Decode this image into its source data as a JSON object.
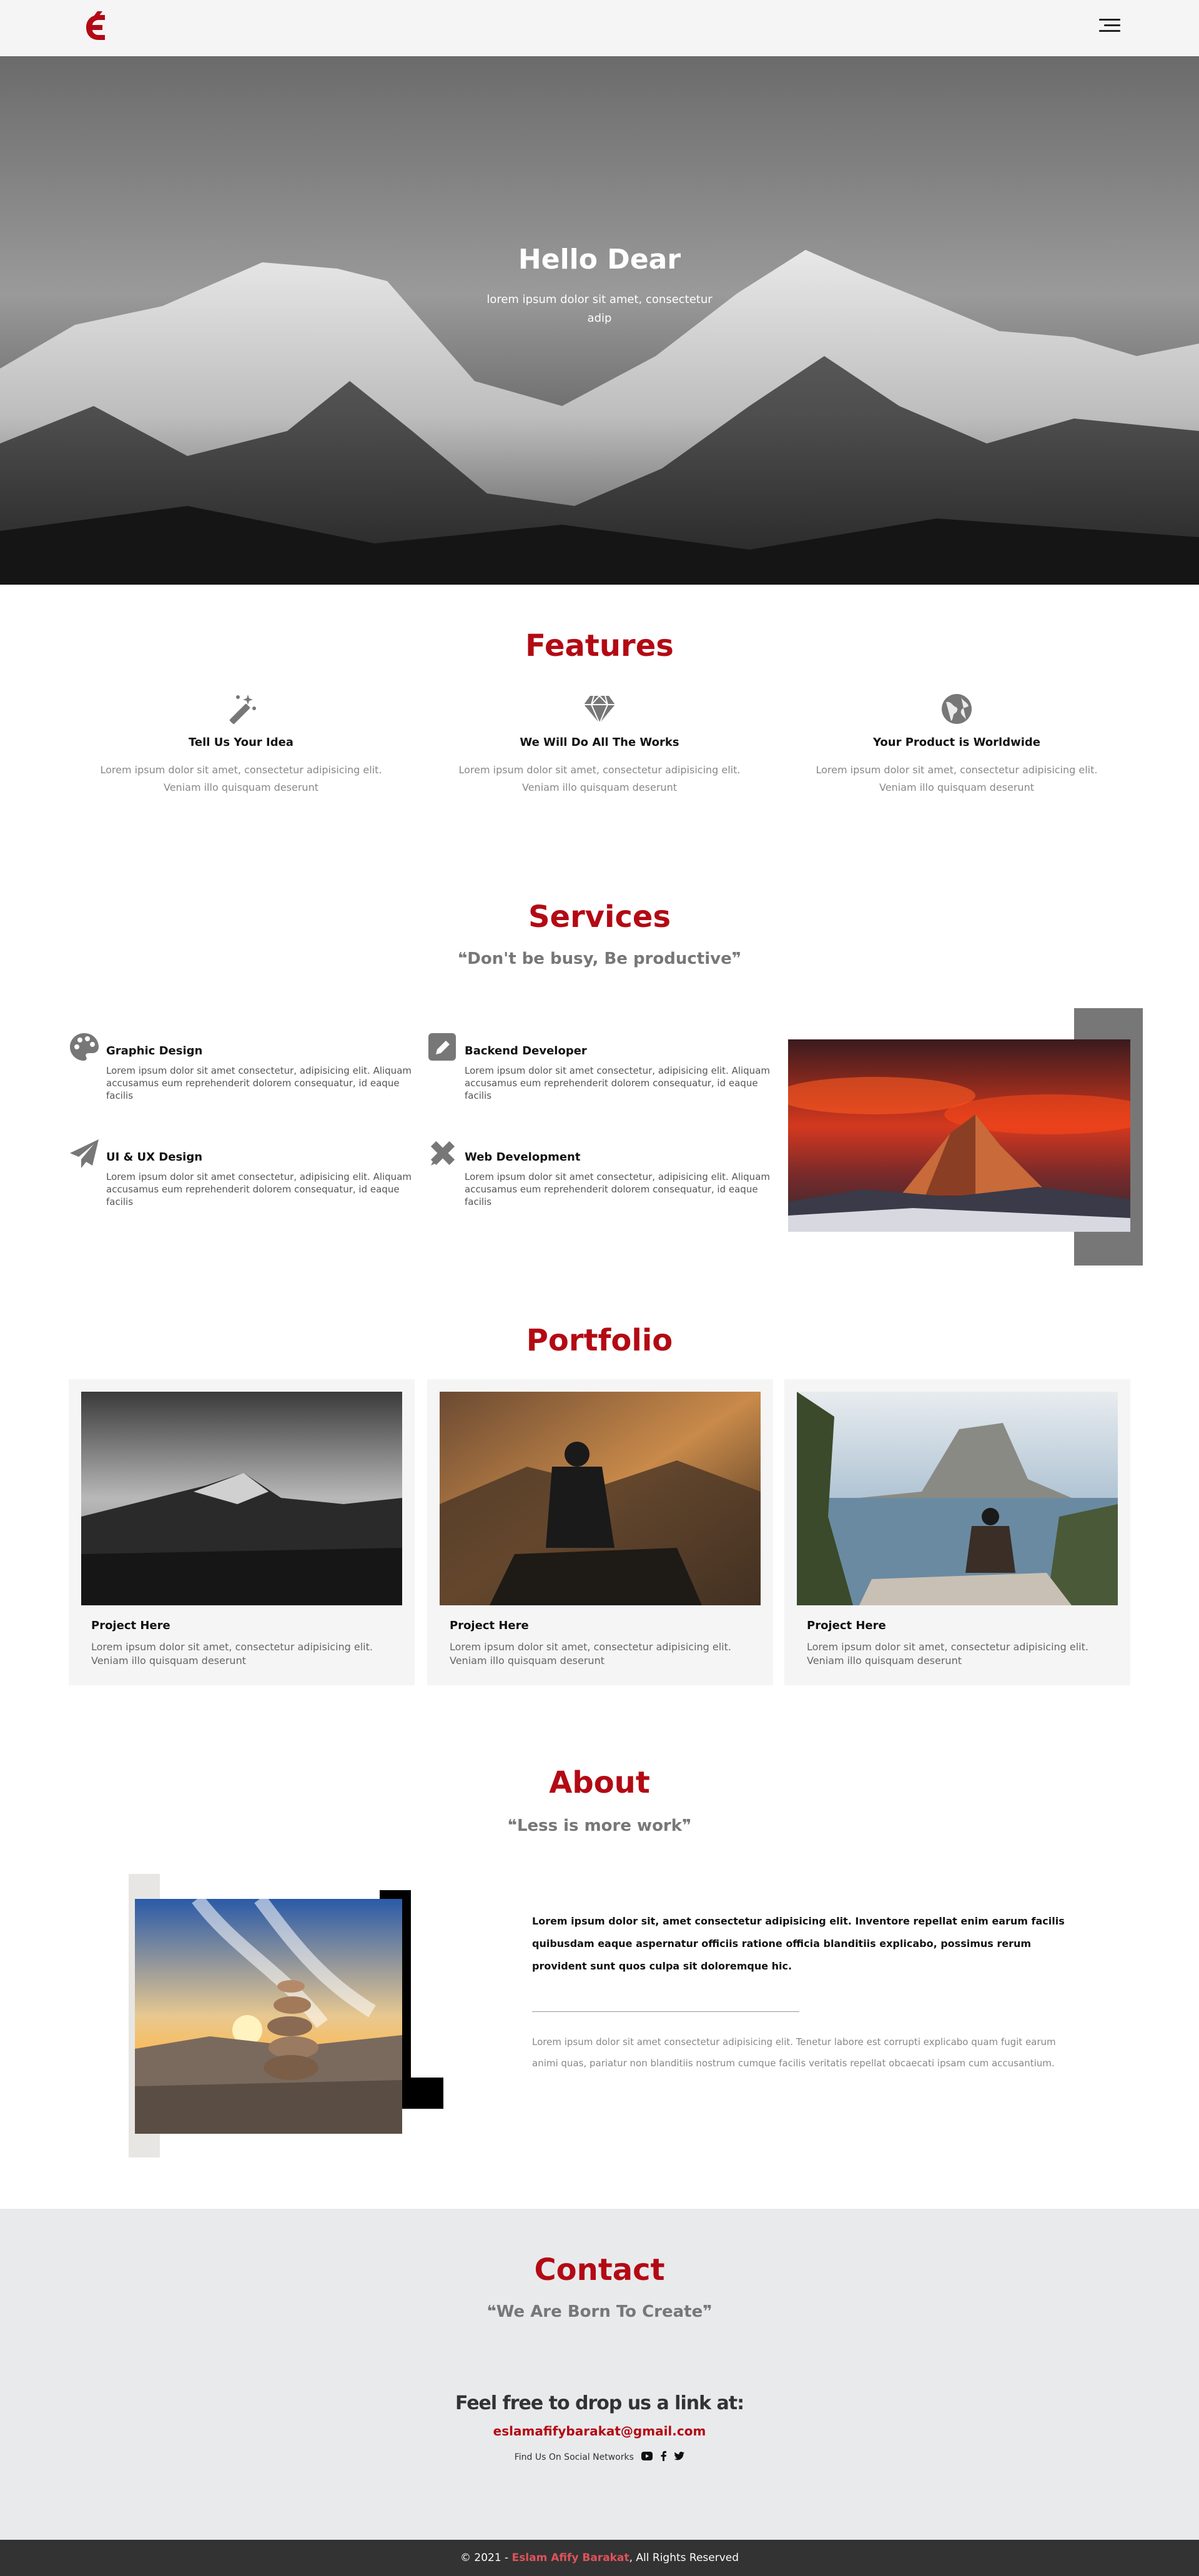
{
  "brand": {
    "logo_letter": "E",
    "accent": "#b30a14"
  },
  "hero": {
    "title": "Hello Dear",
    "subtitle": "lorem ipsum dolor sit amet, consectetur adip"
  },
  "features": {
    "title": "Features",
    "items": [
      {
        "icon": "magic-wand-icon",
        "title": "Tell Us Your Idea",
        "text": "Lorem ipsum dolor sit amet, consectetur adipisicing elit. Veniam illo quisquam deserunt"
      },
      {
        "icon": "diamond-icon",
        "title": "We Will Do All The Works",
        "text": "Lorem ipsum dolor sit amet, consectetur adipisicing elit. Veniam illo quisquam deserunt"
      },
      {
        "icon": "globe-icon",
        "title": "Your Product is Worldwide",
        "text": "Lorem ipsum dolor sit amet, consectetur adipisicing elit. Veniam illo quisquam deserunt"
      }
    ]
  },
  "services": {
    "title": "Services",
    "quote": "Don't be busy, Be productive",
    "items": [
      {
        "icon": "palette-icon",
        "title": "Graphic Design",
        "text": "Lorem ipsum dolor sit amet consectetur, adipisicing elit. Aliquam accusamus eum reprehenderit dolorem consequatur, id eaque facilis"
      },
      {
        "icon": "pen-square-icon",
        "title": "Backend Developer",
        "text": "Lorem ipsum dolor sit amet consectetur, adipisicing elit. Aliquam accusamus eum reprehenderit dolorem consequatur, id eaque facilis"
      },
      {
        "icon": "paper-plane-icon",
        "title": "UI & UX Design",
        "text": "Lorem ipsum dolor sit amet consectetur, adipisicing elit. Aliquam accusamus eum reprehenderit dolorem consequatur, id eaque facilis"
      },
      {
        "icon": "pencil-ruler-icon",
        "title": "Web Development",
        "text": "Lorem ipsum dolor sit amet consectetur, adipisicing elit. Aliquam accusamus eum reprehenderit dolorem consequatur, id eaque facilis"
      }
    ]
  },
  "portfolio": {
    "title": "Portfolio",
    "items": [
      {
        "title": "Project Here",
        "text": "Lorem ipsum dolor sit amet, consectetur adipisicing elit. Veniam illo quisquam deserunt"
      },
      {
        "title": "Project Here",
        "text": "Lorem ipsum dolor sit amet, consectetur adipisicing elit. Veniam illo quisquam deserunt"
      },
      {
        "title": "Project Here",
        "text": "Lorem ipsum dolor sit amet, consectetur adipisicing elit. Veniam illo quisquam deserunt"
      }
    ]
  },
  "about": {
    "title": "About",
    "quote": "Less is more work",
    "bold_text": "Lorem ipsum dolor sit, amet consectetur adipisicing elit. Inventore repellat enim earum facilis quibusdam eaque aspernatur officiis ratione officia blanditiis explicabo, possimus rerum provident sunt quos culpa sit doloremque hic.",
    "text": "Lorem ipsum dolor sit amet consectetur adipisicing elit. Tenetur labore est corrupti explicabo quam fugit earum animi quas, pariatur non blanditiis nostrum cumque facilis veritatis repellat obcaecati ipsam cum accusantium."
  },
  "contact": {
    "title": "Contact",
    "quote": "We Are Born To Create",
    "heading": "Feel free to drop us a link at:",
    "email": "eslamafifybarakat@gmail.com",
    "social_label": "Find Us On Social Networks",
    "social_icons": [
      "youtube-icon",
      "facebook-icon",
      "twitter-icon"
    ]
  },
  "footer": {
    "prefix": "© 2021 - ",
    "author": "Eslam Afify Barakat",
    "suffix": ", All Rights Reserved"
  }
}
